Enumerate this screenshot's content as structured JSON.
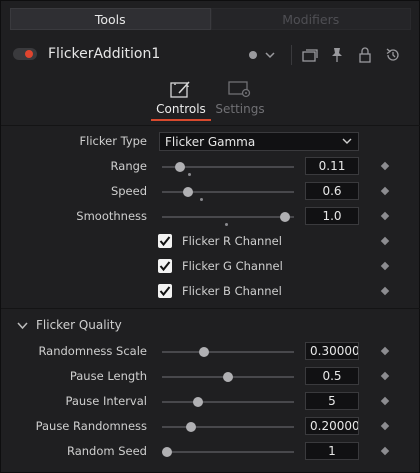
{
  "top_tabs": [
    {
      "label": "Tools",
      "active": true
    },
    {
      "label": "Modifiers",
      "active": false
    }
  ],
  "tool": {
    "name": "FlickerAddition1",
    "enabled": true,
    "accent_color": "#e0452f"
  },
  "sub_tabs": [
    {
      "label": "Controls",
      "icon": "controls-icon",
      "active": true
    },
    {
      "label": "Settings",
      "icon": "settings-icon",
      "active": false
    }
  ],
  "flicker_type": {
    "label": "Flicker Type",
    "value": "Flicker Gamma"
  },
  "controls": {
    "range": {
      "label": "Range",
      "value": "0.11",
      "fraction": 0.11
    },
    "speed": {
      "label": "Speed",
      "value": "0.6",
      "fraction": 0.17
    },
    "smoothness": {
      "label": "Smoothness",
      "value": "1.0",
      "fraction": 0.97
    }
  },
  "channels": [
    {
      "label": "Flicker R Channel",
      "checked": true
    },
    {
      "label": "Flicker G Channel",
      "checked": true
    },
    {
      "label": "Flicker B Channel",
      "checked": true
    }
  ],
  "quality": {
    "title": "Flicker Quality",
    "expanded": true,
    "randomness_scale": {
      "label": "Randomness Scale",
      "value": "0.300000",
      "fraction": 0.3
    },
    "pause_length": {
      "label": "Pause Length",
      "value": "0.5",
      "fraction": 0.5
    },
    "pause_interval": {
      "label": "Pause Interval",
      "value": "5",
      "fraction": 0.25
    },
    "pause_randomness": {
      "label": "Pause Randomness",
      "value": "0.200000",
      "fraction": 0.2
    },
    "random_seed": {
      "label": "Random Seed",
      "value": "1",
      "fraction": 0.0
    }
  }
}
